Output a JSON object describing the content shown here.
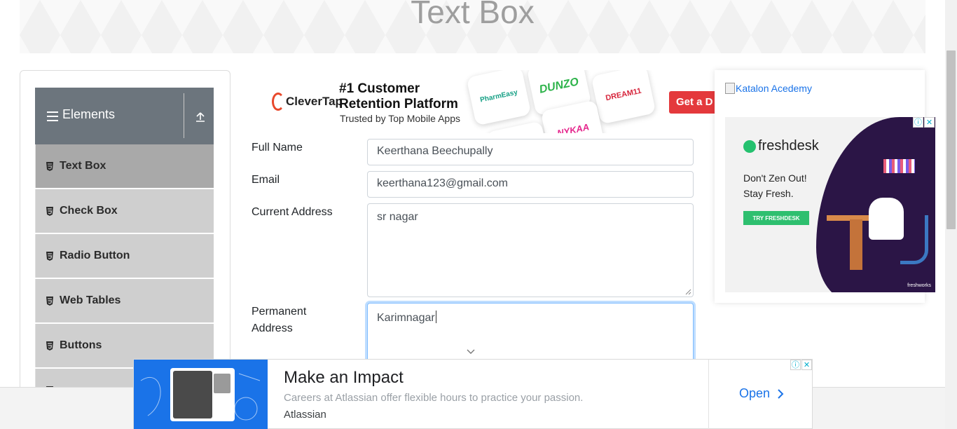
{
  "banner": {
    "title": "Text Box"
  },
  "sidebar": {
    "group_title": "Elements",
    "items": [
      {
        "label": "Text Box",
        "active": true
      },
      {
        "label": "Check Box",
        "active": false
      },
      {
        "label": "Radio Button",
        "active": false
      },
      {
        "label": "Web Tables",
        "active": false
      },
      {
        "label": "Buttons",
        "active": false
      },
      {
        "label": "",
        "active": false
      }
    ]
  },
  "top_ad": {
    "brand": "CleverTap",
    "headline_1": "#1 Customer",
    "headline_2": "Retention Platform",
    "sub": "Trusted by Top Mobile Apps",
    "apps": [
      "PharmEasy",
      "DUNZO",
      "DREAM11",
      "NYKAA"
    ],
    "cta": "Get a D"
  },
  "form": {
    "full_name": {
      "label": "Full Name",
      "value": "Keerthana Beechupally"
    },
    "email": {
      "label": "Email",
      "value": "keerthana123@gmail.com"
    },
    "current_address": {
      "label": "Current Address",
      "value": "sr nagar"
    },
    "permanent_address": {
      "label_1": "Permanent",
      "label_2": "Address",
      "value": "Karimnagar"
    }
  },
  "right_ad": {
    "katalon_alt": "Katalon Acedemy",
    "brand": "freshdesk",
    "tag_line_1": "Don't Zen Out!",
    "tag_line_2": "Stay Fresh.",
    "cta": "TRY FRESHDESK",
    "footer": "freshworks"
  },
  "bottom_ad": {
    "title": "Make an Impact",
    "description": "Careers at Atlassian offer flexible hours to practice your passion.",
    "brand": "Atlassian",
    "cta": "Open"
  },
  "colors": {
    "sidebar_header": "#6c757d",
    "menu_item": "#cfcfcf",
    "menu_item_active": "#a9a9a9",
    "link": "#1a73e8",
    "input_focus": "#80bdff"
  }
}
